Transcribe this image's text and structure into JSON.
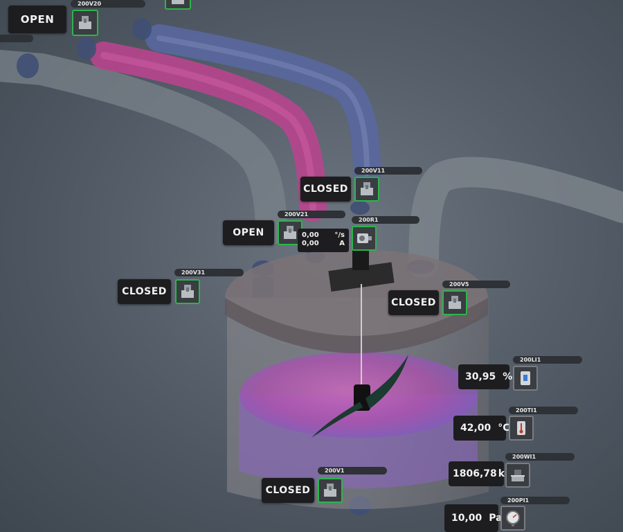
{
  "valves": {
    "v20": {
      "tag": "200V20",
      "status": "OPEN"
    },
    "v11": {
      "tag": "200V11",
      "status": "CLOSED"
    },
    "v21": {
      "tag": "200V21",
      "status": "OPEN"
    },
    "v31": {
      "tag": "200V31",
      "status": "CLOSED"
    },
    "v5": {
      "tag": "200V5",
      "status": "CLOSED"
    },
    "v1": {
      "tag": "200V1",
      "status": "CLOSED"
    }
  },
  "motor": {
    "tag": "200R1",
    "speed_value": "0,00",
    "speed_unit": "°/s",
    "current_value": "0,00",
    "current_unit": "A"
  },
  "sensors": {
    "level": {
      "tag": "200LI1",
      "value": "30,95",
      "unit": "%"
    },
    "temp": {
      "tag": "200TI1",
      "value": "42,00",
      "unit": "°C"
    },
    "weight": {
      "tag": "200WI1",
      "value": "1806,78",
      "unit": "kg"
    },
    "pressure": {
      "tag": "200PI1",
      "value": "10,00",
      "unit": "Pa"
    }
  },
  "colors": {
    "active_border": "#2db54b",
    "pipe_magenta": "#c0418f",
    "pipe_blue": "#5a6aa8",
    "liquid": "#c85ab8"
  },
  "icons": [
    "valve-icon",
    "motor-icon",
    "level-sensor-icon",
    "thermometer-icon",
    "scale-icon",
    "pressure-gauge-icon"
  ]
}
